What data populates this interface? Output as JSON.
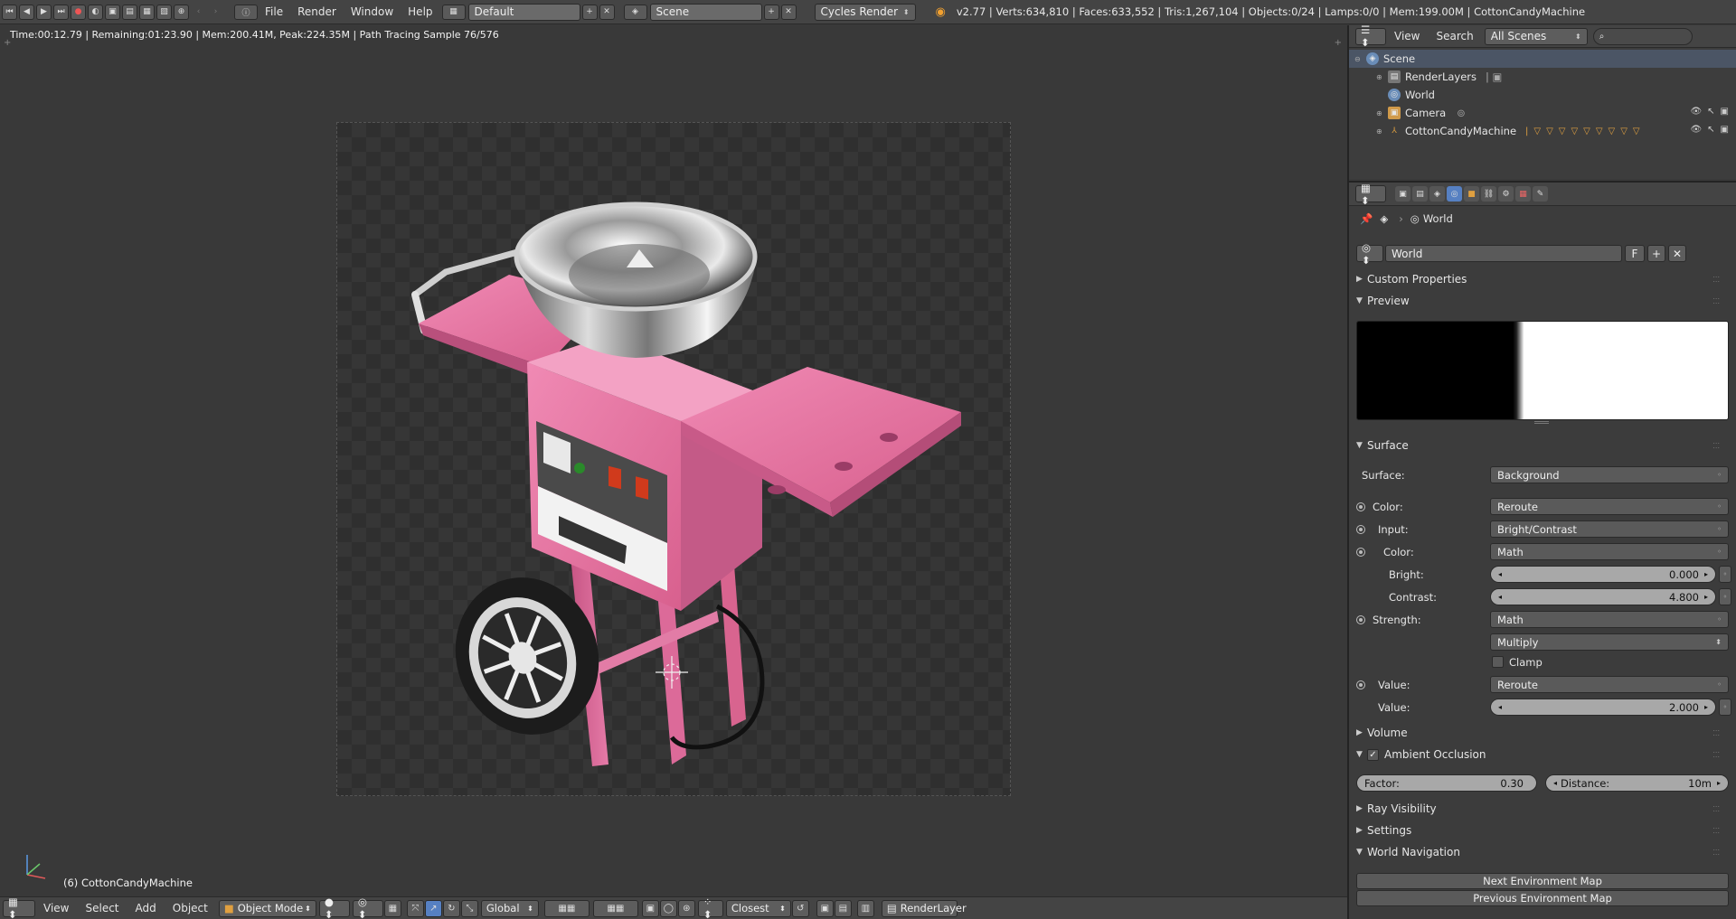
{
  "topbar": {
    "menus": [
      "File",
      "Render",
      "Window",
      "Help"
    ],
    "layout": "Default",
    "scene": "Scene",
    "engine": "Cycles Render",
    "stats": "v2.77 | Verts:634,810 | Faces:633,552 | Tris:1,267,104 | Objects:0/24 | Lamps:0/0 | Mem:199.00M | CottonCandyMachine"
  },
  "viewport": {
    "render_status": "Time:00:12.79 | Remaining:01:23.90 | Mem:200.41M, Peak:224.35M | Path Tracing Sample 76/576",
    "object_label": "(6) CottonCandyMachine"
  },
  "bottombar": {
    "menus": [
      "View",
      "Select",
      "Add",
      "Object"
    ],
    "mode": "Object Mode",
    "orientation": "Global",
    "snap": "Closest",
    "render_layer": "RenderLayer"
  },
  "outliner": {
    "view_label": "View",
    "search_label": "Search",
    "scenes_dropdown": "All Scenes",
    "rows": [
      {
        "label": "Scene"
      },
      {
        "label": "RenderLayers"
      },
      {
        "label": "World"
      },
      {
        "label": "Camera"
      },
      {
        "label": "CottonCandyMachine"
      }
    ]
  },
  "properties": {
    "breadcrumb": "World",
    "world_name": "World",
    "fake_user": "F",
    "panels": {
      "custom_properties": "Custom Properties",
      "preview": "Preview",
      "surface": "Surface",
      "volume": "Volume",
      "ambient_occlusion": "Ambient Occlusion",
      "ray_visibility": "Ray Visibility",
      "settings": "Settings",
      "world_navigation": "World Navigation"
    },
    "surface": {
      "surface_label": "Surface:",
      "surface_value": "Background",
      "color_label": "Color:",
      "color_value": "Reroute",
      "input_label": "Input:",
      "input_value": "Bright/Contrast",
      "color2_label": "Color:",
      "color2_value": "Math",
      "bright_label": "Bright:",
      "bright_value": "0.000",
      "contrast_label": "Contrast:",
      "contrast_value": "4.800",
      "strength_label": "Strength:",
      "strength_value": "Math",
      "operation": "Multiply",
      "clamp_label": "Clamp",
      "value_label": "Value:",
      "value_socket": "Reroute",
      "value2_label": "Value:",
      "value2_value": "2.000"
    },
    "ao": {
      "factor_label": "Factor:",
      "factor_value": "0.30",
      "distance_label": "Distance:",
      "distance_value": "10m"
    },
    "nav": {
      "next": "Next Environment Map",
      "prev": "Previous Environment Map"
    }
  },
  "colors": {
    "accent": "#5680c2",
    "machine_pink": "#e8739f"
  }
}
